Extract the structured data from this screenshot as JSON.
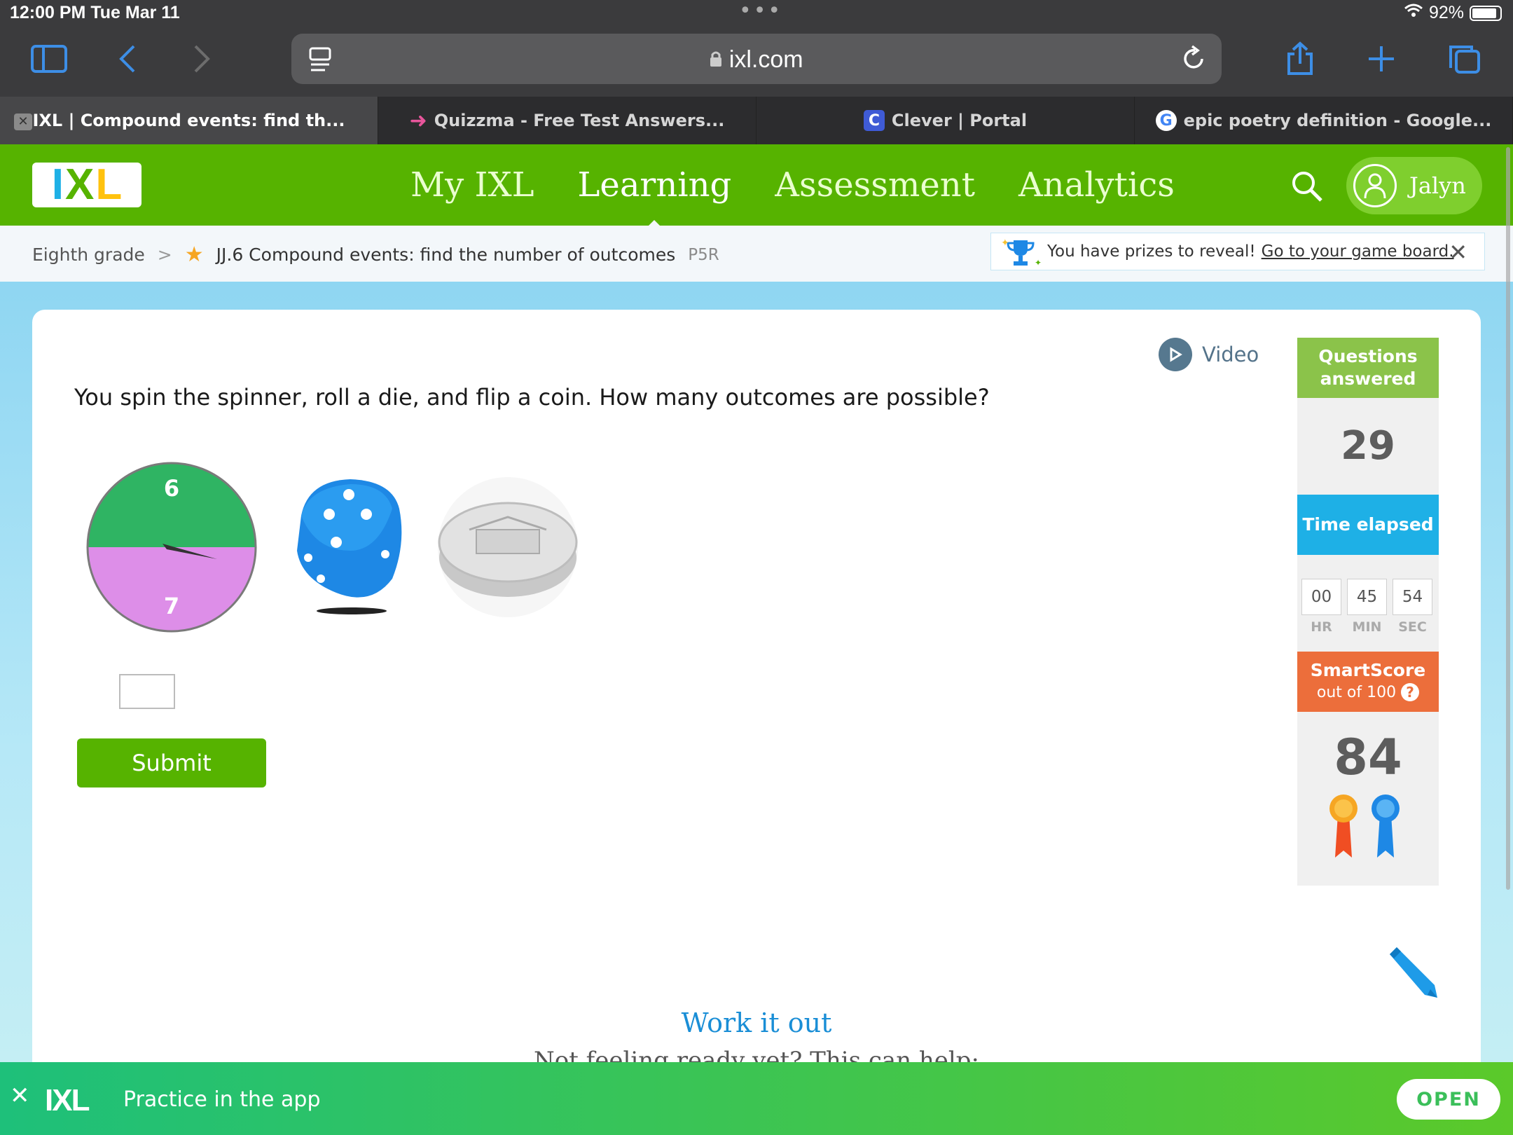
{
  "status_bar": {
    "time": "12:00 PM  Tue Mar 11",
    "battery": "92%"
  },
  "browser": {
    "url": "ixl.com",
    "tabs": [
      {
        "title": "IXL | Compound events: find th...",
        "active": true
      },
      {
        "title": "Quizzma - Free Test Answers...",
        "active": false
      },
      {
        "title": "Clever | Portal",
        "active": false
      },
      {
        "title": "epic poetry definition - Google...",
        "active": false
      }
    ]
  },
  "nav": {
    "logo": "IXL",
    "items": [
      "My IXL",
      "Learning",
      "Assessment",
      "Analytics"
    ],
    "active": "Learning",
    "user": "Jalyn"
  },
  "breadcrumb": {
    "grade": "Eighth grade",
    "skill": "JJ.6 Compound events: find the number of outcomes",
    "code": "P5R"
  },
  "prize_banner": {
    "text": "You have prizes to reveal!",
    "link": "Go to your game board."
  },
  "question": {
    "video_label": "Video",
    "text": "You spin the spinner, roll a die, and flip a coin. How many outcomes are possible?",
    "spinner_labels": [
      "6",
      "7"
    ],
    "answer_value": "",
    "submit_label": "Submit"
  },
  "sidebar": {
    "questions_answered_label": "Questions answered",
    "questions_answered": "29",
    "time_elapsed_label": "Time elapsed",
    "time": {
      "hr": "00",
      "min": "45",
      "sec": "54"
    },
    "time_units": {
      "hr": "HR",
      "min": "MIN",
      "sec": "SEC"
    },
    "smartscore_label": "SmartScore",
    "smartscore_sub": "out of 100",
    "smartscore": "84"
  },
  "work_it_out": {
    "title": "Work it out",
    "subtitle": "Not feeling ready yet? This can help:"
  },
  "app_banner": {
    "logo": "IXL",
    "text": "Practice in the app",
    "button": "OPEN"
  },
  "colors": {
    "ixl_green": "#56b300",
    "spinner_green": "#2fb463",
    "spinner_pink": "#dd8ee8",
    "die_blue": "#1e88e5"
  }
}
